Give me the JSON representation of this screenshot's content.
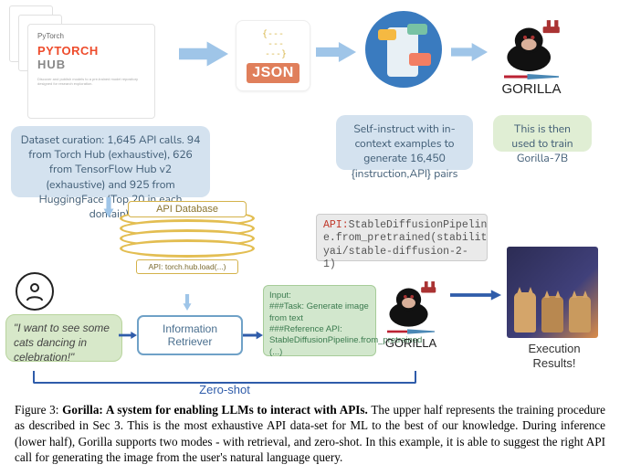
{
  "pytorch": {
    "logo": "PyTorch",
    "title": "PYTORCH",
    "hub": "HUB"
  },
  "json": {
    "label": "JSON"
  },
  "gorilla": {
    "label": "GORILLA"
  },
  "boxes": {
    "dataset": "Dataset curation: 1,645 API calls. 94 from Torch Hub (exhaustive), 626 from TensorFlow Hub v2 (exhaustive) and 925 from HuggingFace (Top 20 in each domain).",
    "self_instruct": "Self-instruct with in-context examples to generate 16,450 {instruction,API} pairs",
    "train": "This is then used to train Gorilla-7B"
  },
  "db": {
    "label": "API Database",
    "inner": "API: torch.hub.load(...)"
  },
  "query": "\"I want to see some cats dancing in celebration!\"",
  "retriever": "Information Retriever",
  "input": {
    "l1": "Input:",
    "l2": "###Task: Generate image from text",
    "l3": "###Reference API: StableDiffusionPipeline.from_pretrained (...)"
  },
  "api_out": "API:StableDiffusionPipeline.from_pretrained(stabilityai/stable-diffusion-2-1)",
  "exec": "Execution Results!",
  "zeroshot": "Zero-shot",
  "caption": {
    "fignum": "Figure 3: ",
    "title": "Gorilla: A system for enabling LLMs to interact with APIs.",
    "body": " The upper half represents the training procedure as described in Sec 3. This is the most exhaustive API data-set for ML to the best of our knowledge. During inference (lower half), Gorilla supports two modes - with retrieval, and zero-shot. In this example, it is able to suggest the right API call for generating the image from the user's natural language query."
  }
}
